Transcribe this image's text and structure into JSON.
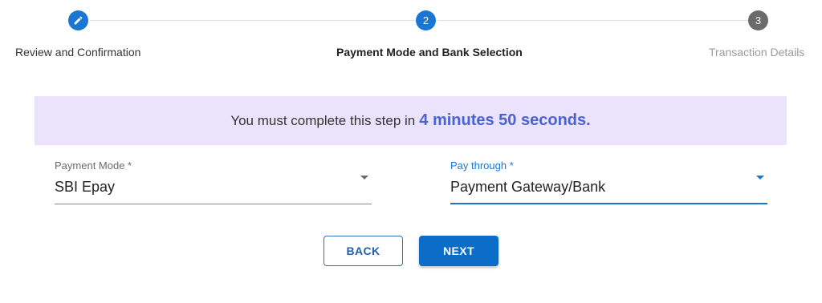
{
  "stepper": {
    "steps": [
      {
        "label": "Review and Confirmation",
        "number": "",
        "state": "completed",
        "icon": "pencil-icon"
      },
      {
        "label": "Payment Mode and Bank Selection",
        "number": "2",
        "state": "active"
      },
      {
        "label": "Transaction Details",
        "number": "3",
        "state": "pending"
      }
    ]
  },
  "timer": {
    "prefix": "You must complete this step in",
    "value": "4 minutes 50 seconds."
  },
  "payment_mode": {
    "label": "Payment Mode *",
    "value": "SBI Epay",
    "icon": "dropdown-arrow-icon"
  },
  "pay_through": {
    "label": "Pay through *",
    "value": "Payment Gateway/Bank",
    "icon": "dropdown-arrow-icon"
  },
  "actions": {
    "back_label": "BACK",
    "next_label": "NEXT"
  },
  "colors": {
    "primary": "#1976d2",
    "step_pending": "#6b6b6b",
    "banner_bg": "#ebe3fb",
    "timer_accent": "#4a63cf",
    "button_primary": "#0b6dc7"
  }
}
